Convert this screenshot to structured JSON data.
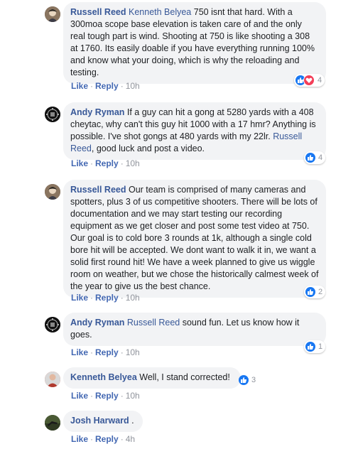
{
  "comments": [
    {
      "name": "Russell Reed",
      "tag": "Kenneth Belyea",
      "text_after_tag": " 750 isnt that hard. With a 300moa scope base elevation is taken care of and the only real tough part is wind. Shooting at 750 is like shooting a 308 at 1760. Its easily doable if you have everything running 100% and know what your doing, which is why the reloading and testing.",
      "like": "Like",
      "reply": "Reply",
      "time": "10h",
      "reactions": [
        "like-icon",
        "love-icon"
      ],
      "reaction_count": "4"
    },
    {
      "name": "Andy Ryman",
      "text_before_tag": " If a guy can hit a gong at 5280 yards with a 408 cheytac, why can't this guy hit 1000 with a 17 hmr? Anything is possible. I've shot gongs at 480 yards with my 22lr. ",
      "tag": "Russell Reed",
      "text_after_tag": ", good luck and post a video.",
      "like": "Like",
      "reply": "Reply",
      "time": "10h",
      "reactions": [
        "like-icon"
      ],
      "reaction_count": "4"
    },
    {
      "name": "Russell Reed",
      "text": " Our team is comprised of many cameras and spotters, plus 3 of us competitive shooters. There will be lots of documentation and we may start testing our recording equipment as we get closer and post some test video at 750. Our goal is to cold bore 3 rounds at 1k, although a single cold bore hit will be accepted. We dont want to walk it in, we want a solid first round hit! We have a week planned to give us wiggle room on weather, but we chose the historically calmest week of the year to give us the best chance.",
      "like": "Like",
      "reply": "Reply",
      "time": "10h",
      "reactions": [
        "like-icon"
      ],
      "reaction_count": "2"
    },
    {
      "name": "Andy Ryman",
      "tag": "Russell Reed",
      "text_after_tag": " sound fun. Let us know how it goes.",
      "like": "Like",
      "reply": "Reply",
      "time": "10h",
      "reactions": [
        "like-icon"
      ],
      "reaction_count": "1"
    },
    {
      "name": "Kenneth Belyea",
      "text": " Well, I stand corrected!",
      "like": "Like",
      "reply": "Reply",
      "time": "10h",
      "reactions": [
        "like-icon"
      ],
      "reaction_count": "3"
    },
    {
      "name": "Josh Harward",
      "text": " .",
      "like": "Like",
      "reply": "Reply",
      "time": "4h"
    }
  ],
  "colors": {
    "name_link": "#385898",
    "action_link": "#4267b2",
    "bubble_bg": "#f2f3f5",
    "like_blue": "#1877f2",
    "love_red": "#f33e58"
  }
}
